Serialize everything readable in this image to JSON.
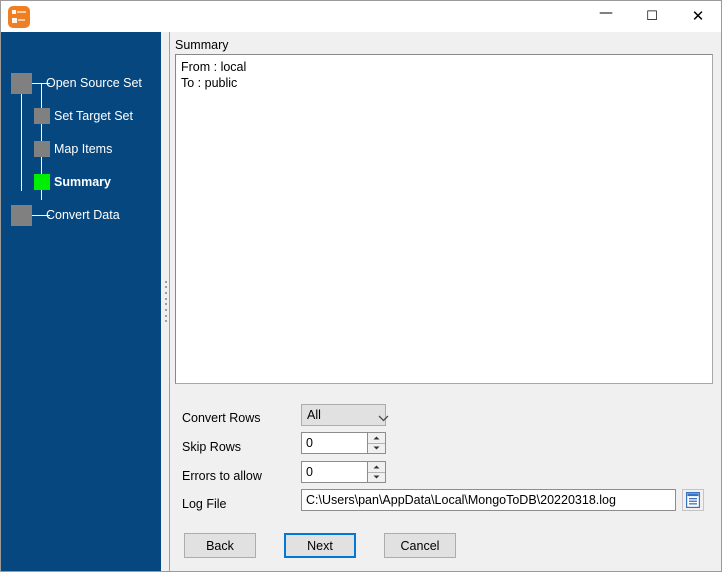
{
  "window": {
    "title": "",
    "app_icon": "app-orange-icon",
    "controls": {
      "minimize": "—",
      "maximize": "☐",
      "close": "✕"
    }
  },
  "sidebar": {
    "background_color": "#06477f",
    "current_step": 3,
    "steps": [
      {
        "label": "Open Source Set",
        "state": "done",
        "box_color": "#808080"
      },
      {
        "label": "Set Target Set",
        "state": "done",
        "box_color": "#808080"
      },
      {
        "label": "Map Items",
        "state": "done",
        "box_color": "#808080"
      },
      {
        "label": "Summary",
        "state": "current",
        "box_color": "#00ef00"
      },
      {
        "label": "Convert Data",
        "state": "pending",
        "box_color": "#808080"
      }
    ]
  },
  "content": {
    "summary": {
      "group_label": "Summary",
      "lines": [
        "From : local",
        "To : public"
      ]
    },
    "fields": {
      "convert_rows": {
        "label": "Convert Rows",
        "value": "All",
        "options": [
          "All"
        ],
        "icon": "chevron-down-icon"
      },
      "skip_rows": {
        "label": "Skip Rows",
        "value": "0"
      },
      "errors_to_allow": {
        "label": "Errors to allow",
        "value": "0"
      },
      "log_file": {
        "label": "Log File",
        "value": "C:\\Users\\pan\\AppData\\Local\\MongoToDB\\20220318.log",
        "browse_icon": "document-icon"
      }
    },
    "buttons": {
      "back": "Back",
      "next": "Next",
      "cancel": "Cancel",
      "focused": "next"
    }
  }
}
